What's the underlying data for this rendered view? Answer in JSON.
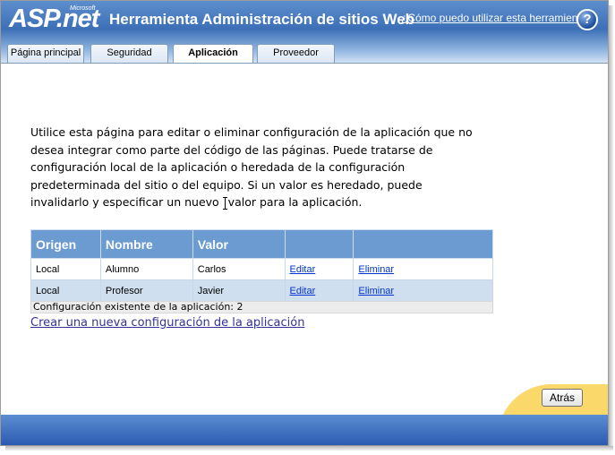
{
  "header": {
    "logo_text": "ASP.net",
    "logo_small": "Microsoft",
    "title": "Herramienta Administración de sitios Web",
    "help_link": "¿Cómo puedo utilizar esta herramienta?",
    "help_icon_glyph": "?"
  },
  "tabs": [
    {
      "label": "Página principal",
      "active": false
    },
    {
      "label": "Seguridad",
      "active": false
    },
    {
      "label": "Aplicación",
      "active": true
    },
    {
      "label": "Proveedor",
      "active": false
    }
  ],
  "intro_text": {
    "line1": "Utilice esta página para editar o eliminar configuración de la aplicación que no",
    "line2": "desea integrar como parte del código de las páginas. Puede tratarse de",
    "line3": "configuración local de la aplicación o heredada de la configuración",
    "line4": "predeterminada del sitio o del equipo. Si un valor es heredado, puede",
    "line5a": "invalidarlo y especificar un nuevo",
    "line5b": "valor para la aplicación."
  },
  "settings_table": {
    "columns": [
      "Origen",
      "Nombre",
      "Valor",
      "",
      ""
    ],
    "rows": [
      {
        "origen": "Local",
        "nombre": "Alumno",
        "valor": "Carlos",
        "edit": "Editar",
        "delete": "Eliminar"
      },
      {
        "origen": "Local",
        "nombre": "Profesor",
        "valor": "Javier",
        "edit": "Editar",
        "delete": "Eliminar"
      }
    ]
  },
  "count_text": "Configuración existente de la aplicación: 2",
  "create_link": "Crear una nueva configuración de la aplicación",
  "back_button": "Atrás",
  "colors": {
    "header_blue": "#3c6fb6",
    "table_header": "#6b9bd1",
    "row_alt": "#d0dff0",
    "footer_yellow": "#fbd86a",
    "footer_blue": "#2b5bb0",
    "link": "#0033cc"
  }
}
